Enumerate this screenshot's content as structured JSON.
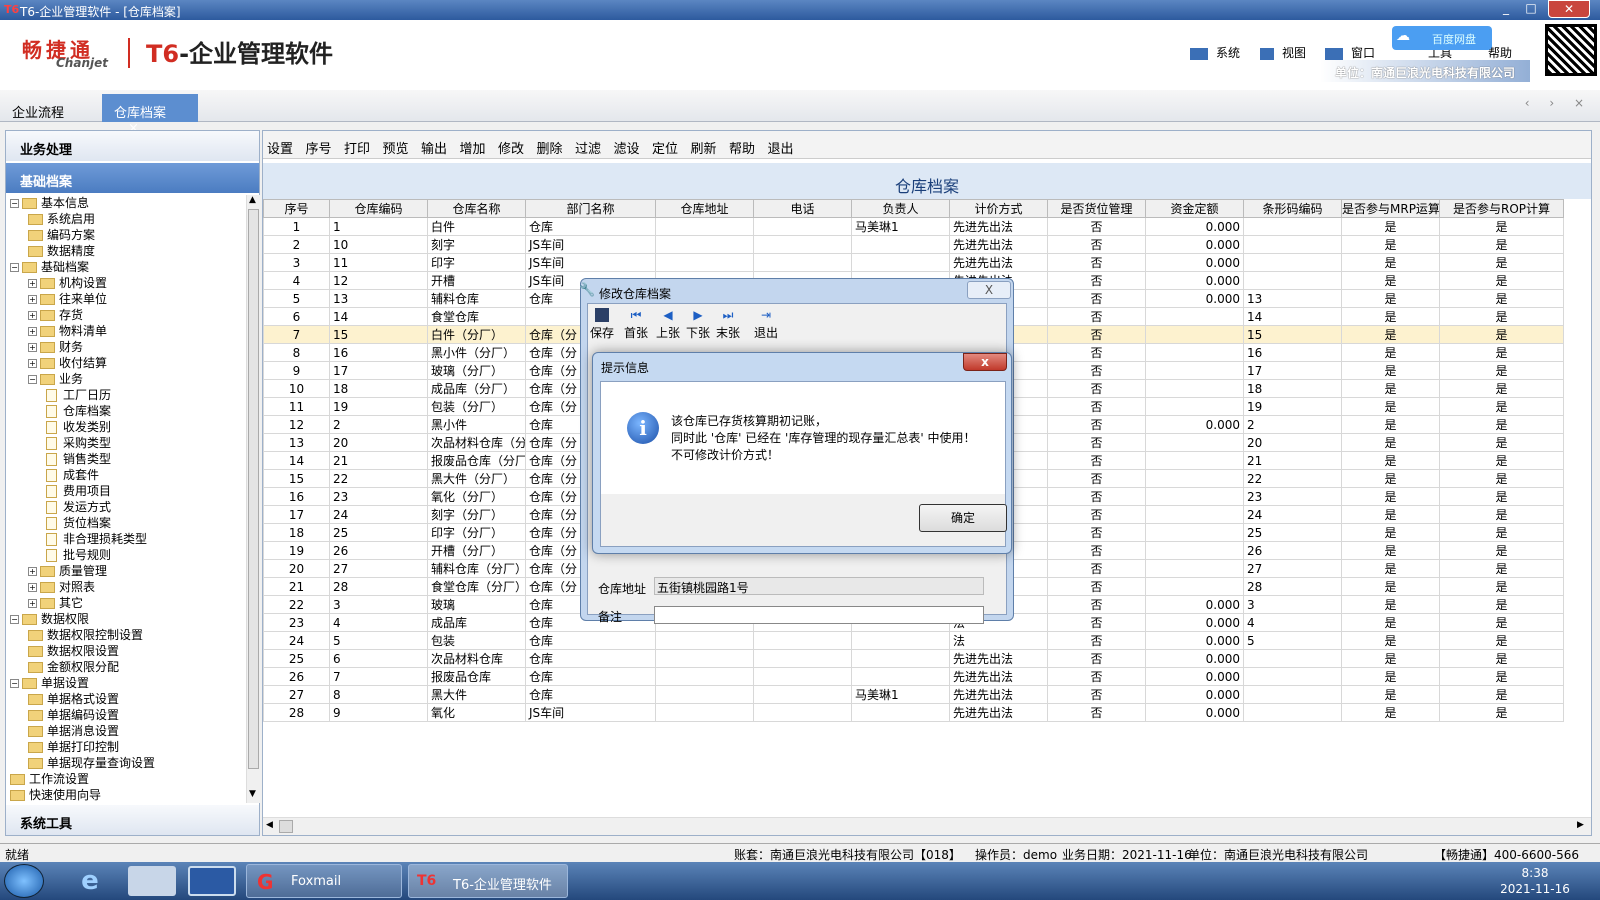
{
  "window": {
    "logo": "T6",
    "title": "T6-企业管理软件 - [仓库档案]"
  },
  "header": {
    "brand_cn": "畅捷通",
    "brand_en": "Chanjet",
    "product_prefix": "T6",
    "product_suffix": "-企业管理软件",
    "menu": [
      "系统",
      "视图",
      "窗口",
      "工具",
      "帮助"
    ],
    "unit": "单位：南通巨浪光电科技有限公司",
    "floating_badge": "百度网盘"
  },
  "tabs": {
    "items": [
      "企业流程",
      "仓库档案"
    ],
    "active_close": "×",
    "nav": "‹ › ×"
  },
  "left": {
    "bar_top": "业务处理",
    "bar_active": "基础档案",
    "bar_bottom": "系统工具",
    "tree": [
      {
        "label": "基本信息",
        "level": 0,
        "type": "folder",
        "exp": "−"
      },
      {
        "label": "系统启用",
        "level": 1,
        "type": "folder",
        "exp": ""
      },
      {
        "label": "编码方案",
        "level": 1,
        "type": "folder",
        "exp": ""
      },
      {
        "label": "数据精度",
        "level": 1,
        "type": "folder",
        "exp": ""
      },
      {
        "label": "基础档案",
        "level": 0,
        "type": "folder",
        "exp": "−"
      },
      {
        "label": "机构设置",
        "level": 1,
        "type": "folder",
        "exp": "+"
      },
      {
        "label": "往来单位",
        "level": 1,
        "type": "folder",
        "exp": "+"
      },
      {
        "label": "存货",
        "level": 1,
        "type": "folder",
        "exp": "+"
      },
      {
        "label": "物料清单",
        "level": 1,
        "type": "folder",
        "exp": "+"
      },
      {
        "label": "财务",
        "level": 1,
        "type": "folder",
        "exp": "+"
      },
      {
        "label": "收付结算",
        "level": 1,
        "type": "folder",
        "exp": "+"
      },
      {
        "label": "业务",
        "level": 1,
        "type": "folder",
        "exp": "−"
      },
      {
        "label": "工厂日历",
        "level": 2,
        "type": "leaf",
        "exp": ""
      },
      {
        "label": "仓库档案",
        "level": 2,
        "type": "leaf",
        "exp": ""
      },
      {
        "label": "收发类别",
        "level": 2,
        "type": "leaf",
        "exp": ""
      },
      {
        "label": "采购类型",
        "level": 2,
        "type": "leaf",
        "exp": ""
      },
      {
        "label": "销售类型",
        "level": 2,
        "type": "leaf",
        "exp": ""
      },
      {
        "label": "成套件",
        "level": 2,
        "type": "leaf",
        "exp": ""
      },
      {
        "label": "费用项目",
        "level": 2,
        "type": "leaf",
        "exp": ""
      },
      {
        "label": "发运方式",
        "level": 2,
        "type": "leaf",
        "exp": ""
      },
      {
        "label": "货位档案",
        "level": 2,
        "type": "leaf",
        "exp": ""
      },
      {
        "label": "非合理损耗类型",
        "level": 2,
        "type": "leaf",
        "exp": ""
      },
      {
        "label": "批号规则",
        "level": 2,
        "type": "leaf",
        "exp": ""
      },
      {
        "label": "质量管理",
        "level": 1,
        "type": "folder",
        "exp": "+"
      },
      {
        "label": "对照表",
        "level": 1,
        "type": "folder",
        "exp": "+"
      },
      {
        "label": "其它",
        "level": 1,
        "type": "folder",
        "exp": "+"
      },
      {
        "label": "数据权限",
        "level": 0,
        "type": "folder",
        "exp": "−"
      },
      {
        "label": "数据权限控制设置",
        "level": 1,
        "type": "folder",
        "exp": ""
      },
      {
        "label": "数据权限设置",
        "level": 1,
        "type": "folder",
        "exp": ""
      },
      {
        "label": "金额权限分配",
        "level": 1,
        "type": "folder",
        "exp": ""
      },
      {
        "label": "单据设置",
        "level": 0,
        "type": "folder",
        "exp": "−"
      },
      {
        "label": "单据格式设置",
        "level": 1,
        "type": "folder",
        "exp": ""
      },
      {
        "label": "单据编码设置",
        "level": 1,
        "type": "folder",
        "exp": ""
      },
      {
        "label": "单据消息设置",
        "level": 1,
        "type": "folder",
        "exp": ""
      },
      {
        "label": "单据打印控制",
        "level": 1,
        "type": "folder",
        "exp": ""
      },
      {
        "label": "单据现存量查询设置",
        "level": 1,
        "type": "folder",
        "exp": ""
      },
      {
        "label": "工作流设置",
        "level": 0,
        "type": "folder",
        "exp": ""
      },
      {
        "label": "快速使用向导",
        "level": 0,
        "type": "folder",
        "exp": ""
      }
    ]
  },
  "toolbar": [
    "设置",
    "序号",
    "打印",
    "预览",
    "输出",
    "增加",
    "修改",
    "删除",
    "过滤",
    "滤设",
    "定位",
    "刷新",
    "帮助",
    "退出"
  ],
  "grid": {
    "title": "仓库档案",
    "columns": [
      "序号",
      "仓库编码",
      "仓库名称",
      "部门名称",
      "仓库地址",
      "电话",
      "负责人",
      "计价方式",
      "是否货位管理",
      "资金定额",
      "条形码编码",
      "是否参与MRP运算",
      "是否参与ROP计算"
    ],
    "selected_row": 6,
    "rows": [
      [
        "1",
        "1",
        "白件",
        "仓库",
        "",
        "",
        "马美琳1",
        "先进先出法",
        "否",
        "0.000",
        "",
        "是",
        "是"
      ],
      [
        "2",
        "10",
        "刻字",
        "JS车间",
        "",
        "",
        "",
        "先进先出法",
        "否",
        "0.000",
        "",
        "是",
        "是"
      ],
      [
        "3",
        "11",
        "印字",
        "JS车间",
        "",
        "",
        "",
        "先进先出法",
        "否",
        "0.000",
        "",
        "是",
        "是"
      ],
      [
        "4",
        "12",
        "开槽",
        "JS车间",
        "",
        "",
        "",
        "先进先出法",
        "否",
        "0.000",
        "",
        "是",
        "是"
      ],
      [
        "5",
        "13",
        "辅料仓库",
        "仓库",
        "",
        "",
        "",
        "先进先出法",
        "否",
        "0.000",
        "13",
        "是",
        "是"
      ],
      [
        "6",
        "14",
        "食堂仓库",
        "",
        "",
        "",
        "",
        "",
        "否",
        "",
        "14",
        "是",
        "是"
      ],
      [
        "7",
        "15",
        "白件（分厂）",
        "仓库（分",
        "",
        "",
        "",
        "法",
        "否",
        "",
        "15",
        "是",
        "是"
      ],
      [
        "8",
        "16",
        "黑小件（分厂）",
        "仓库（分",
        "",
        "",
        "",
        "法",
        "否",
        "",
        "16",
        "是",
        "是"
      ],
      [
        "9",
        "17",
        "玻璃（分厂）",
        "仓库（分",
        "",
        "",
        "",
        "法",
        "否",
        "",
        "17",
        "是",
        "是"
      ],
      [
        "10",
        "18",
        "成品库（分厂）",
        "仓库（分",
        "",
        "",
        "",
        "法",
        "否",
        "",
        "18",
        "是",
        "是"
      ],
      [
        "11",
        "19",
        "包装（分厂）",
        "仓库（分",
        "",
        "",
        "",
        "法",
        "否",
        "",
        "19",
        "是",
        "是"
      ],
      [
        "12",
        "2",
        "黑小件",
        "仓库",
        "",
        "",
        "",
        "法",
        "否",
        "0.000",
        "2",
        "是",
        "是"
      ],
      [
        "13",
        "20",
        "次品材料仓库（分",
        "仓库（分",
        "",
        "",
        "",
        "法",
        "否",
        "",
        "20",
        "是",
        "是"
      ],
      [
        "14",
        "21",
        "报废品仓库（分厂",
        "仓库（分",
        "",
        "",
        "",
        "法",
        "否",
        "",
        "21",
        "是",
        "是"
      ],
      [
        "15",
        "22",
        "黑大件（分厂）",
        "仓库（分",
        "",
        "",
        "",
        "法",
        "否",
        "",
        "22",
        "是",
        "是"
      ],
      [
        "16",
        "23",
        "氧化（分厂）",
        "仓库（分",
        "",
        "",
        "",
        "法",
        "否",
        "",
        "23",
        "是",
        "是"
      ],
      [
        "17",
        "24",
        "刻字（分厂）",
        "仓库（分",
        "",
        "",
        "",
        "法",
        "否",
        "",
        "24",
        "是",
        "是"
      ],
      [
        "18",
        "25",
        "印字（分厂）",
        "仓库（分",
        "",
        "",
        "",
        "法",
        "否",
        "",
        "25",
        "是",
        "是"
      ],
      [
        "19",
        "26",
        "开槽（分厂）",
        "仓库（分",
        "",
        "",
        "",
        "法",
        "否",
        "",
        "26",
        "是",
        "是"
      ],
      [
        "20",
        "27",
        "辅料仓库（分厂）",
        "仓库（分",
        "",
        "",
        "",
        "法",
        "否",
        "",
        "27",
        "是",
        "是"
      ],
      [
        "21",
        "28",
        "食堂仓库（分厂）",
        "仓库（分",
        "",
        "",
        "",
        "法",
        "否",
        "",
        "28",
        "是",
        "是"
      ],
      [
        "22",
        "3",
        "玻璃",
        "仓库",
        "",
        "",
        "",
        "法",
        "否",
        "0.000",
        "3",
        "是",
        "是"
      ],
      [
        "23",
        "4",
        "成品库",
        "仓库",
        "",
        "",
        "",
        "法",
        "否",
        "0.000",
        "4",
        "是",
        "是"
      ],
      [
        "24",
        "5",
        "包装",
        "仓库",
        "",
        "",
        "",
        "法",
        "否",
        "0.000",
        "5",
        "是",
        "是"
      ],
      [
        "25",
        "6",
        "次品材料仓库",
        "仓库",
        "",
        "",
        "",
        "先进先出法",
        "否",
        "0.000",
        "",
        "是",
        "是"
      ],
      [
        "26",
        "7",
        "报废品仓库",
        "仓库",
        "",
        "",
        "",
        "先进先出法",
        "否",
        "0.000",
        "",
        "是",
        "是"
      ],
      [
        "27",
        "8",
        "黑大件",
        "仓库",
        "",
        "",
        "马美琳1",
        "先进先出法",
        "否",
        "0.000",
        "",
        "是",
        "是"
      ],
      [
        "28",
        "9",
        "氧化",
        "JS车间",
        "",
        "",
        "",
        "先进先出法",
        "否",
        "0.000",
        "",
        "是",
        "是"
      ]
    ]
  },
  "edit_dialog": {
    "title": "修改仓库档案",
    "close": "X",
    "buttons": [
      "保存",
      "首张",
      "上张",
      "下张",
      "末张",
      "退出"
    ],
    "address_label": "仓库地址",
    "address_value": "五街镇桃园路1号",
    "memo_label": "备注",
    "memo_value": ""
  },
  "alert": {
    "title": "提示信息",
    "close": "x",
    "icon": "i",
    "lines": [
      "该仓库已存货核算期初记账，",
      "同时此 '仓库' 已经在 '库存管理的现存量汇总表' 中使用！",
      "不可修改计价方式！"
    ],
    "ok": "确定"
  },
  "status": {
    "ready": "就绪",
    "account": "账套：南通巨浪光电科技有限公司【018】",
    "operator": "操作员：demo",
    "date": "业务日期：2021-11-16",
    "unit": "单位：南通巨浪光电科技有限公司",
    "hotline": "【畅捷通】400-6600-566"
  },
  "taskbar": {
    "tasks": [
      "Foxmail",
      "T6-企业管理软件 ..."
    ],
    "time": "8:38",
    "date": "2021-11-16"
  }
}
